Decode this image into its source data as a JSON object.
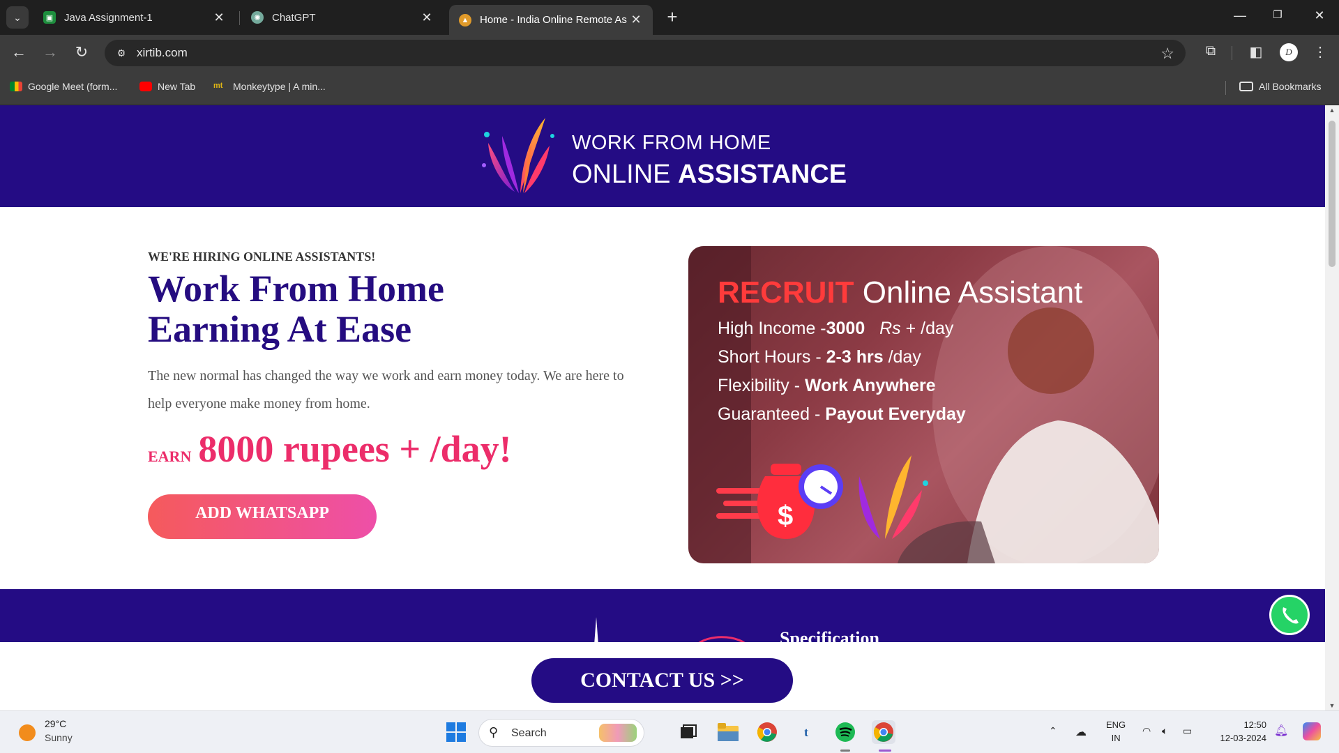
{
  "browser": {
    "tabs": [
      {
        "title": "Java Assignment-1",
        "favicon": "classroom-icon",
        "active": false
      },
      {
        "title": "ChatGPT",
        "favicon": "chatgpt-icon",
        "active": false
      },
      {
        "title": "Home - India Online Remote As",
        "favicon": "site-icon",
        "active": true
      }
    ],
    "url": "xirtib.com",
    "bookmarks": [
      {
        "label": "Google Meet (form...",
        "icon": "meet-icon"
      },
      {
        "label": "New Tab",
        "icon": "youtube-icon"
      },
      {
        "label": "Monkeytype | A min...",
        "icon": "monkeytype-icon"
      }
    ],
    "all_bookmarks_label": "All Bookmarks",
    "profile_initial": "D",
    "monkeytype_glyph": "mt"
  },
  "site": {
    "logo_line1": "WORK FROM HOME",
    "logo_line2_regular": "ONLINE",
    "logo_line2_bold": "ASSISTANCE",
    "hiring_label": "WE'RE HIRING ONLINE ASSISTANTS!",
    "headline_line1": "Work From Home",
    "headline_line2": "Earning At Ease",
    "intro": "The new normal has changed the way we work and earn money today. We are here to help everyone make money from home.",
    "earn_small": "EARN",
    "earn_big": "8000 rupees + /day!",
    "whatsapp_button": "ADD WHATSAPP",
    "promo": {
      "title_highlight": "RECRUIT",
      "title_rest": "Online Assistant",
      "line1_label": "High Income -",
      "line1_value": "3000",
      "line1_unit": "Rs",
      "line1_suffix": "+ /day",
      "line2_label": "Short Hours -",
      "line2_value": "2-3 hrs",
      "line2_suffix": "/day",
      "line3_label": "Flexibility -",
      "line3_value": "Work Anywhere",
      "line4_label": "Guaranteed -",
      "line4_value": "Payout Everyday"
    },
    "specification_label": "Specification",
    "contact_button": "CONTACT US >>"
  },
  "taskbar": {
    "temperature": "29°C",
    "condition": "Sunny",
    "search_placeholder": "Search",
    "lang_top": "ENG",
    "lang_bottom": "IN",
    "time": "12:50",
    "date": "12-03-2024"
  },
  "colors": {
    "brand_purple": "#240c84",
    "accent_pink": "#ec2d6a",
    "recruit_red": "#ff3b3b"
  }
}
